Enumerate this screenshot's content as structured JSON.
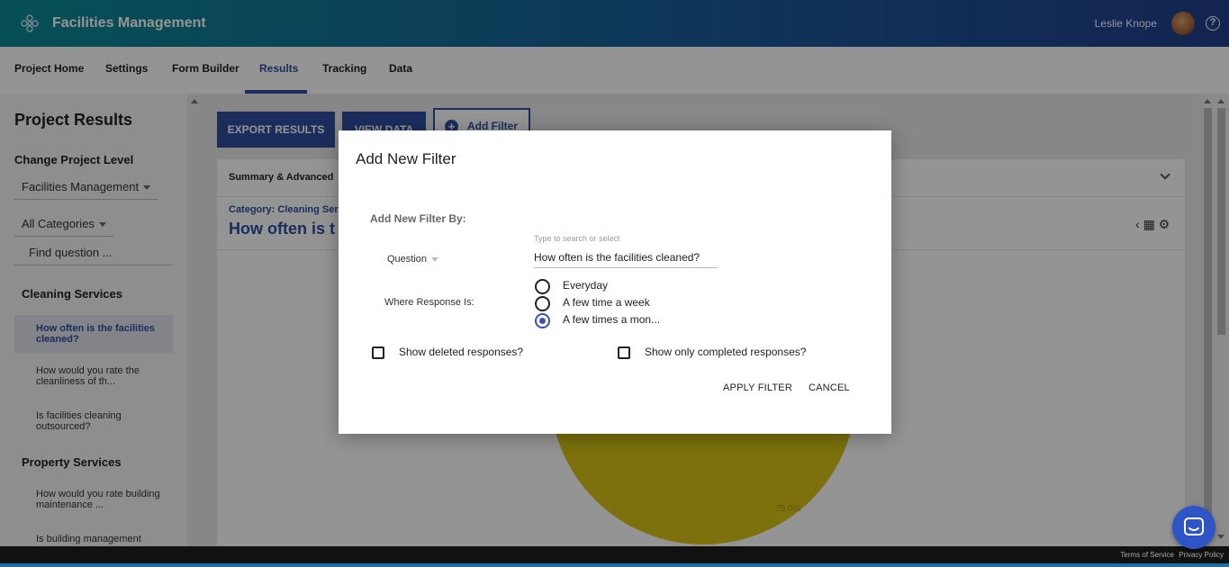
{
  "header": {
    "app_title": "Facilities Management",
    "user_name": "Leslie Knope",
    "help_glyph": "?"
  },
  "nav": {
    "items": [
      {
        "label": "Project Home",
        "active": false
      },
      {
        "label": "Settings",
        "active": false
      },
      {
        "label": "Form Builder",
        "active": false
      },
      {
        "label": "Results",
        "active": true
      },
      {
        "label": "Tracking",
        "active": false
      },
      {
        "label": "Data",
        "active": false
      }
    ]
  },
  "sidebar": {
    "title": "Project Results",
    "change_level_label": "Change Project Level",
    "project_level": "Facilities Management",
    "category_filter": "All Categories",
    "search_placeholder": "Find question ...",
    "sections": [
      {
        "name": "Cleaning Services",
        "items": [
          {
            "label": "How often is the facilities cleaned?",
            "active": true
          },
          {
            "label": "How would you rate the cleanliness of th...",
            "active": false
          },
          {
            "label": "Is facilities cleaning outsourced?",
            "active": false
          }
        ]
      },
      {
        "name": "Property Services",
        "items": [
          {
            "label": "How would you rate building maintenance ...",
            "active": false
          },
          {
            "label": "Is building management",
            "active": false
          }
        ]
      }
    ]
  },
  "main": {
    "export_label": "EXPORT RESULTS",
    "view_data_label": "VIEW DATA",
    "add_filter_label": "Add Filter",
    "summary_title": "Summary & Advanced",
    "category_text": "Category: Cleaning Serv",
    "question_title": "How often is t",
    "chart_percent_label": "75.0%",
    "chart_color": "#d6c317"
  },
  "modal": {
    "title": "Add New Filter",
    "filter_by_label": "Add New Filter By:",
    "filter_type": "Question",
    "search_hint": "Type to search or select",
    "search_value": "How often is the facilities cleaned?",
    "where_label": "Where Response Is:",
    "responses": [
      {
        "label": "Everyday",
        "checked": false
      },
      {
        "label": "A few time a week",
        "checked": false
      },
      {
        "label": "A few times a mon...",
        "checked": true
      }
    ],
    "show_deleted_label": "Show deleted responses?",
    "show_deleted_checked": false,
    "show_completed_label": "Show only completed responses?",
    "show_completed_checked": false,
    "apply_label": "APPLY FILTER",
    "cancel_label": "CANCEL"
  },
  "footer": {
    "terms": "Terms of Service",
    "privacy": "Privacy Policy"
  },
  "colors": {
    "accent": "#2d4ea0",
    "radio_selected": "#3f51b5",
    "chat_button": "#2d55c8"
  }
}
